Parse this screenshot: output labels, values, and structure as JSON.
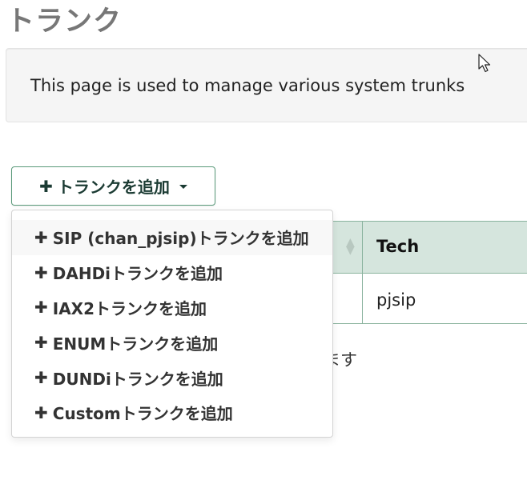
{
  "page": {
    "title": "トランク"
  },
  "info": {
    "text": "This page is used to manage various system trunks"
  },
  "toolbar": {
    "add_trunk_label": "トランクを追加",
    "plus_glyph": "✚"
  },
  "table": {
    "columns": [
      {
        "label": ""
      },
      {
        "label": "Tech"
      }
    ],
    "rows": [
      {
        "tech": "pjsip"
      }
    ],
    "footer_fragment": "ます"
  },
  "dropdown": {
    "items": [
      {
        "label": "SIP (chan_pjsip)トランクを追加"
      },
      {
        "label": "DAHDiトランクを追加"
      },
      {
        "label": "IAX2トランクを追加"
      },
      {
        "label": "ENUMトランクを追加"
      },
      {
        "label": "DUNDiトランクを追加"
      },
      {
        "label": "Customトランクを追加"
      }
    ]
  },
  "colors": {
    "header_bg": "#d5e5dd",
    "border": "#8ab39e",
    "button_border": "#5a9a7a",
    "title": "#777777"
  }
}
